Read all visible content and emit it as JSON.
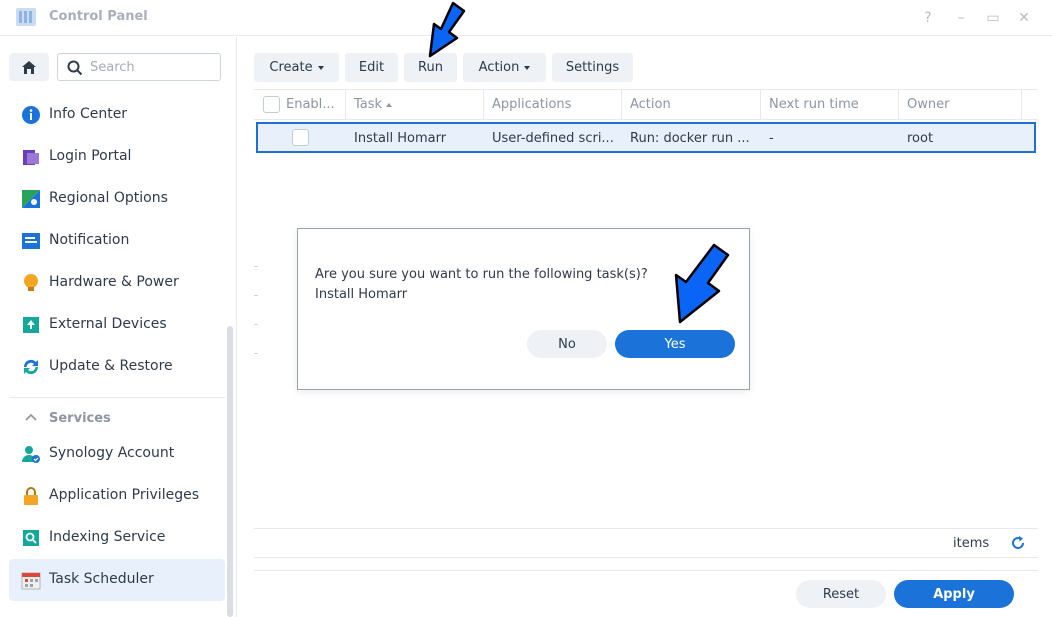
{
  "window": {
    "title": "Control Panel",
    "buttons": [
      "?",
      "–",
      "▭",
      "✕"
    ]
  },
  "sidebar": {
    "search_placeholder": "Search",
    "items": [
      {
        "label": "Info Center",
        "icon": "info-icon"
      },
      {
        "label": "Login Portal",
        "icon": "login-portal-icon"
      },
      {
        "label": "Regional Options",
        "icon": "regional-options-icon"
      },
      {
        "label": "Notification",
        "icon": "notification-icon"
      },
      {
        "label": "Hardware & Power",
        "icon": "hardware-power-icon"
      },
      {
        "label": "External Devices",
        "icon": "external-devices-icon"
      },
      {
        "label": "Update & Restore",
        "icon": "update-restore-icon"
      }
    ],
    "services_label": "Services",
    "service_items": [
      {
        "label": "Synology Account",
        "icon": "synology-account-icon"
      },
      {
        "label": "Application Privileges",
        "icon": "lock-icon"
      },
      {
        "label": "Indexing Service",
        "icon": "indexing-icon"
      },
      {
        "label": "Task Scheduler",
        "icon": "calendar-icon",
        "active": true
      }
    ]
  },
  "toolbar": {
    "create": "Create",
    "edit": "Edit",
    "run": "Run",
    "action": "Action",
    "settings": "Settings"
  },
  "table": {
    "columns": [
      "Enabl...",
      "Task",
      "Applications",
      "Action",
      "Next run time",
      "Owner"
    ],
    "rows": [
      {
        "enabled": false,
        "task": "Install Homarr",
        "applications": "User-defined scri...",
        "action": "Run: docker run ...",
        "next_run_time": "-",
        "owner": "root"
      }
    ]
  },
  "footer": {
    "items_label": "items",
    "reset": "Reset",
    "apply": "Apply"
  },
  "dialog": {
    "message_line1": "Are you sure you want to run the following task(s)?",
    "message_line2": "Install Homarr",
    "no": "No",
    "yes": "Yes"
  },
  "colors": {
    "accent": "#1b73d9",
    "arrow": "#0a64f5",
    "selected_row_bg": "#e8f0fb"
  }
}
